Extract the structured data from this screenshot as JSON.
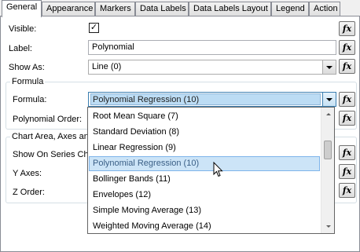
{
  "tabs": [
    "General",
    "Appearance",
    "Markers",
    "Data Labels",
    "Data Labels Layout",
    "Legend",
    "Action"
  ],
  "fx_label": "fx",
  "visible": {
    "label": "Visible:",
    "checked": "✓"
  },
  "label_field": {
    "label": "Label:",
    "value": "Polynomial"
  },
  "show_as": {
    "label": "Show As:",
    "value": "Line (0)"
  },
  "formula_group": {
    "title": "Formula",
    "formula_label": "Formula:",
    "formula_value": "Polynomial Regression (10)",
    "order_label": "Polynomial Order:"
  },
  "chart_area_group": {
    "title": "Chart Area, Axes and",
    "show_on_series": "Show On Series Cha",
    "y_axes": "Y Axes:",
    "z_order": "Z Order:"
  },
  "dropdown_items": [
    "Root Mean Square (7)",
    "Standard Deviation (8)",
    "Linear Regression (9)",
    "Polynomial Regression (10)",
    "Bollinger Bands (11)",
    "Envelopes (12)",
    "Simple Moving Average (13)",
    "Weighted Moving Average (14)"
  ],
  "highlighted_index": 3,
  "colors": {
    "selection": "#cce4f7",
    "selection_border": "#7eb4ea"
  }
}
